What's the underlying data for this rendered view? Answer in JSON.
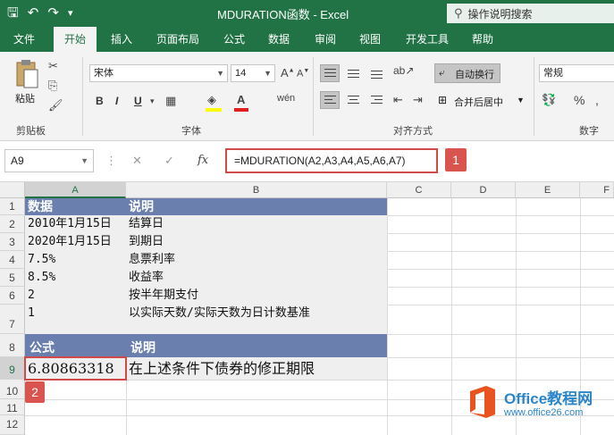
{
  "titlebar": {
    "title": "MDURATION函数 - Excel",
    "search_placeholder": "操作说明搜索"
  },
  "tabs": [
    "文件",
    "开始",
    "插入",
    "页面布局",
    "公式",
    "数据",
    "审阅",
    "视图",
    "开发工具",
    "帮助"
  ],
  "ribbon": {
    "paste_label": "粘贴",
    "clipboard_label": "剪贴板",
    "font_name": "宋体",
    "font_size": "14",
    "font_group_label": "字体",
    "wrap_text_label": "自动换行",
    "merge_label": "合并后居中",
    "alignment_group_label": "对齐方式",
    "number_format": "常规",
    "number_group_label": "数字"
  },
  "formula_bar": {
    "name_box": "A9",
    "formula": "=MDURATION(A2,A3,A4,A5,A6,A7)"
  },
  "callouts": [
    "1",
    "2"
  ],
  "columns": [
    "A",
    "B",
    "C",
    "D",
    "E",
    "F"
  ],
  "rows": [
    "1",
    "2",
    "3",
    "4",
    "5",
    "6",
    "7",
    "8",
    "9",
    "10",
    "11",
    "12"
  ],
  "cells": {
    "A1": "数据",
    "B1": "说明",
    "A2": "2010年1月15日",
    "B2": "结算日",
    "A3": "2020年1月15日",
    "B3": "到期日",
    "A4": "7.5%",
    "B4": "息票利率",
    "A5": "8.5%",
    "B5": "收益率",
    "A6": "2",
    "B6": "按半年期支付",
    "A7": "1",
    "B7": "以实际天数/实际天数为日计数基准",
    "A8": "公式",
    "B8": "说明",
    "A9": "6.80863318",
    "B9": "在上述条件下债券的修正期限"
  },
  "logo": {
    "brand": "Office教程网",
    "url": "www.office26.com"
  },
  "colors": {
    "excel_green": "#217346",
    "header_band": "#6a7fae",
    "callout_red": "#d9534f"
  }
}
